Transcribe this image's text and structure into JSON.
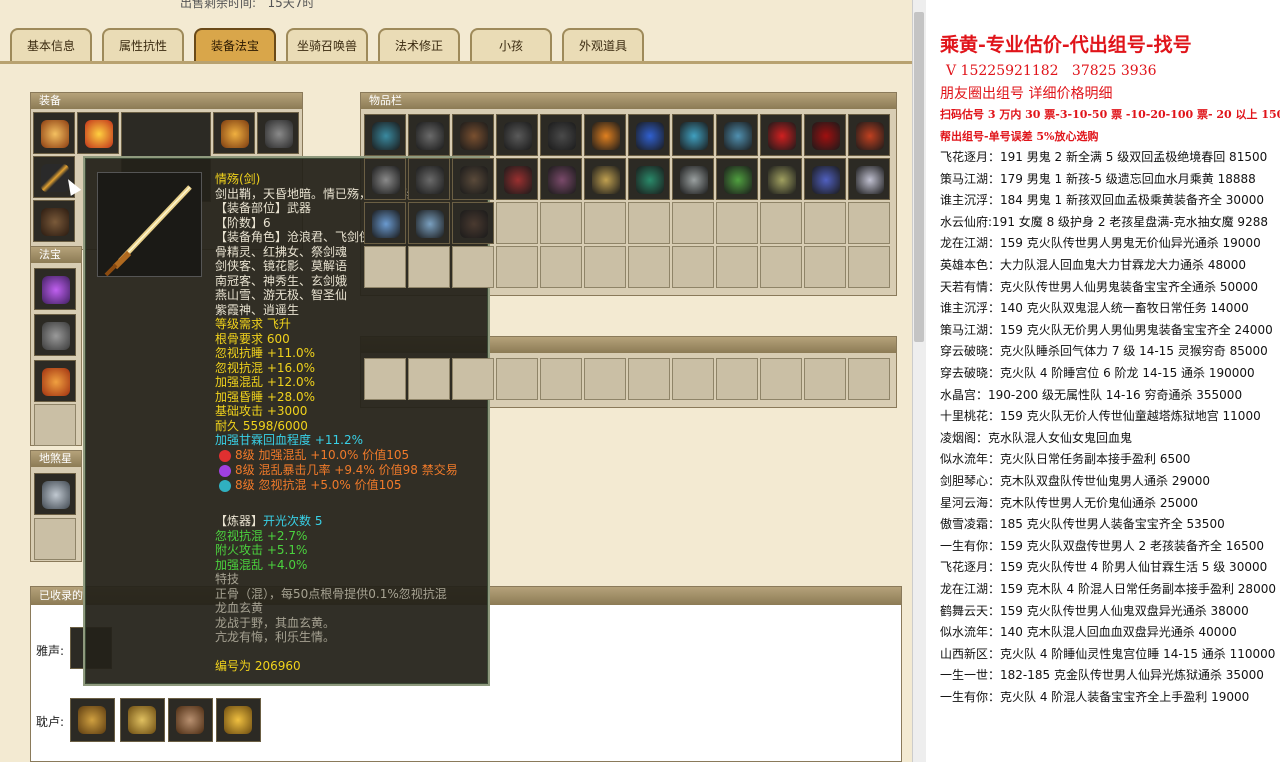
{
  "top_label": "出售剩余时间:",
  "top_value": "15天7时",
  "tabs": [
    "基本信息",
    "属性抗性",
    "装备法宝",
    "坐骑召唤兽",
    "法术修正",
    "小孩",
    "外观道具"
  ],
  "panels": {
    "equip": "装备",
    "treasure": "法宝",
    "mount": "地煞星",
    "collected": "已收录的",
    "inventory": "物品栏"
  },
  "collected_rows": [
    "雅声:",
    "耽卢:"
  ],
  "tooltip": {
    "name": "情殇(剑)",
    "desc": "剑出鞘，天昏地暗。情已殇，此恨不绝。",
    "part": "【装备部位】武器",
    "level": "【阶数】6",
    "roles": [
      "【装备角色】沧浪君、飞剑侠",
      "骨精灵、红拂女、祭剑魂",
      "剑侠客、镜花影、莫解语",
      "南冠客、神秀生、玄剑娥",
      "燕山雪、游无极、智圣仙",
      "紫霞神、逍遥生"
    ],
    "req_level": "等级需求 飞升",
    "req_bone": "根骨要求 600",
    "attrs": [
      "忽视抗睡 +11.0%",
      "忽视抗混 +16.0%",
      "加强混乱 +12.0%",
      "加强昏睡 +28.0%",
      "基础攻击 +3000",
      "耐久 5598/6000"
    ],
    "special": "加强甘霖回血程度 +11.2%",
    "gems": [
      "8级 加强混乱 +10.0% 价值105",
      "8级 混乱暴击几率 +9.4% 价值98 禁交易",
      "8级 忽视抗混 +5.0% 价值105"
    ],
    "refine_title": "【炼器】",
    "refine_count": "开光次数 5",
    "refine_attrs": [
      "忽视抗混 +2.7%",
      "附火攻击 +5.1%",
      "加强混乱 +4.0%"
    ],
    "skill_title": "特技",
    "skill_lines": [
      "正骨（混），每50点根骨提供0.1%忽视抗混",
      "龙血玄黄",
      "龙战于野，其血玄黄。",
      "亢龙有悔，利乐生情。"
    ],
    "serial": "编号为 206960"
  },
  "right_header": {
    "title": "乘黄-专业估价-代出组号-找号",
    "phone": "V 15225921182",
    "phone2": "37825 3936",
    "line2": "朋友圈出组号 详细价格明细",
    "prices": "扫码估号 3 万内 30 票-3-10-50 票 -10-20-100 票- 20 以上 150",
    "help": "帮出组号-单号误差 5%放心选购"
  },
  "listings": [
    "飞花逐月：191 男鬼 2 新全满 5 级双回孟极绝境春回 81500",
    "策马江湖：179 男鬼 1 新孩-5 级遗忘回血水月乘黄 18888",
    "谁主沉浮：184 男鬼 1 新孩双回血孟极乘黄装备齐全 30000",
    "水云仙府:191 女魔 8 级护身 2 老孩星盘满-克水抽女魔 9288",
    "龙在江湖：159 克火队传世男人男鬼无价仙异光通杀 19000",
    "英雄本色：大力队混人回血鬼大力甘霖龙大力通杀 48000",
    "天若有情：克火队传世男人仙男鬼装备宝宝齐全通杀 50000",
    "谁主沉浮：140 克火队双鬼混人统一畜牧日常任务 14000",
    "策马江湖：159 克火队无价男人男仙男鬼装备宝宝齐全 24000",
    "穿云破晓：克火队睡杀回气体力 7 级 14-15 灵猴穷奇 85000",
    "穿去破晓：克火队 4 阶睡宫位 6 阶龙 14-15 通杀 190000",
    "水晶宫：190-200 级无属性队 14-16 穷奇通杀 355000",
    "十里桃花：159 克火队无价人传世仙童越塔炼狱地宫 11000",
    "凌烟阁：克水队混人女仙女鬼回血鬼",
    "似水流年：克火队日常任务副本接手盈利 6500",
    "剑胆琴心：克木队双盘队传世仙鬼男人通杀 29000",
    "星河云海：克木队传世男人无价鬼仙通杀 25000",
    "傲雪凌霜：185 克火队传世男人装备宝宝齐全 53500",
    "一生有你：159 克火队双盘传世男人 2 老孩装备齐全 16500",
    "飞花逐月：159 克火队传世 4 阶男人仙甘霖生活 5 级 30000",
    "龙在江湖：159 克木队 4 阶混人日常任务副本接手盈利 28000",
    "鹤舞云天：159 克火队传世男人仙鬼双盘异光通杀 38000",
    "似水流年：140 克木队混人回血血双盘异光通杀 40000",
    "山西新区：克火队 4 阶睡仙灵性鬼宫位睡 14-15 通杀 110000",
    "一生一世：182-185 克金队传世男人仙异光炼狱通杀 35000",
    "一生有你：克火队 4 阶混人装备宝宝齐全上手盈利 19000"
  ],
  "colors": {
    "title_red": "#e0141a",
    "tooltip_bg": "#24221a",
    "accent_gold": "#d9a64a"
  }
}
